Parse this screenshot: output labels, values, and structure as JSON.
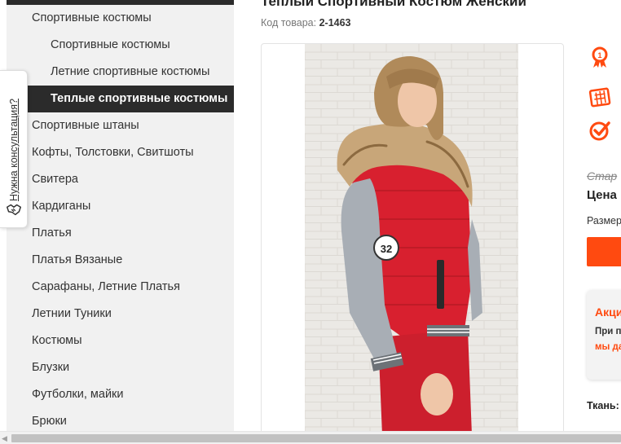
{
  "sidebar": {
    "items": [
      {
        "label": "Спортивные костюмы",
        "level": 1
      },
      {
        "label": "Спортивные костюмы",
        "level": 2
      },
      {
        "label": "Летние спортивные костюмы",
        "level": 2
      },
      {
        "label": "Теплые спортивные костюмы",
        "level": 2,
        "active": true
      },
      {
        "label": "Спортивные штаны",
        "level": 1
      },
      {
        "label": "Кофты, Толстовки, Свитшоты",
        "level": 1
      },
      {
        "label": "Свитера",
        "level": 1
      },
      {
        "label": "Кардиганы",
        "level": 1
      },
      {
        "label": "Платья",
        "level": 1
      },
      {
        "label": "Платья Вязаные",
        "level": 1
      },
      {
        "label": "Сарафаны, Летние Платья",
        "level": 1
      },
      {
        "label": "Летнии Туники",
        "level": 1
      },
      {
        "label": "Костюмы",
        "level": 1
      },
      {
        "label": "Блузки",
        "level": 1
      },
      {
        "label": "Футболки, майки",
        "level": 1
      },
      {
        "label": "Брюки",
        "level": 1
      }
    ]
  },
  "consultation": {
    "label": "Нужна консультация?",
    "icon": "handshake-icon"
  },
  "product": {
    "title": "Теплый Спортивный Костюм Женский",
    "sku_label": "Код товара:",
    "sku_value": "2-1463",
    "image_badge": "32"
  },
  "right_column": {
    "features": [
      {
        "icon": "award-icon"
      },
      {
        "icon": "calendar-icon"
      },
      {
        "icon": "checkmark-icon"
      }
    ],
    "old_price_label": "Стар",
    "price_label": "Цена",
    "size_label": "Размер",
    "promo_title": "Акци",
    "promo_text": "При п",
    "promo_text2": "мы да",
    "fabric_label": "Ткань:"
  },
  "colors": {
    "accent": "#ff4a10",
    "sidebar_bg": "#f1f1f1",
    "active_bg": "#2b2b2b",
    "jacket_red": "#d8202f",
    "sleeve_gray": "#a8aeb5"
  }
}
